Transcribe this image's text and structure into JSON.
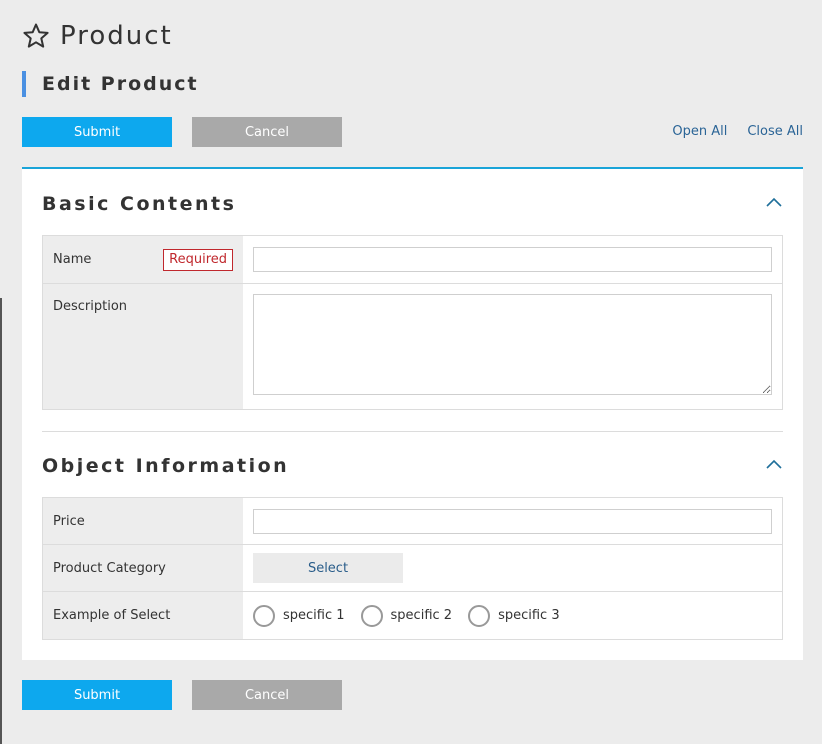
{
  "header": {
    "title": "Product",
    "icon": "star-icon"
  },
  "subtitle": {
    "text": "Edit Product",
    "accent_color": "#4a90e2"
  },
  "actions": {
    "submit_label": "Submit",
    "cancel_label": "Cancel",
    "open_all_label": "Open All",
    "close_all_label": "Close All",
    "submit_color": "#0da8ee",
    "cancel_color": "#a9a9a9"
  },
  "basic_contents": {
    "title": "Basic Contents",
    "name_label": "Name",
    "required_label": "Required",
    "name_value": "",
    "description_label": "Description",
    "description_value": ""
  },
  "object_information": {
    "title": "Object Information",
    "price_label": "Price",
    "price_value": "",
    "category_label": "Product Category",
    "select_label": "Select",
    "example_label": "Example of Select",
    "options": [
      "specific 1",
      "specific 2",
      "specific 3"
    ]
  }
}
